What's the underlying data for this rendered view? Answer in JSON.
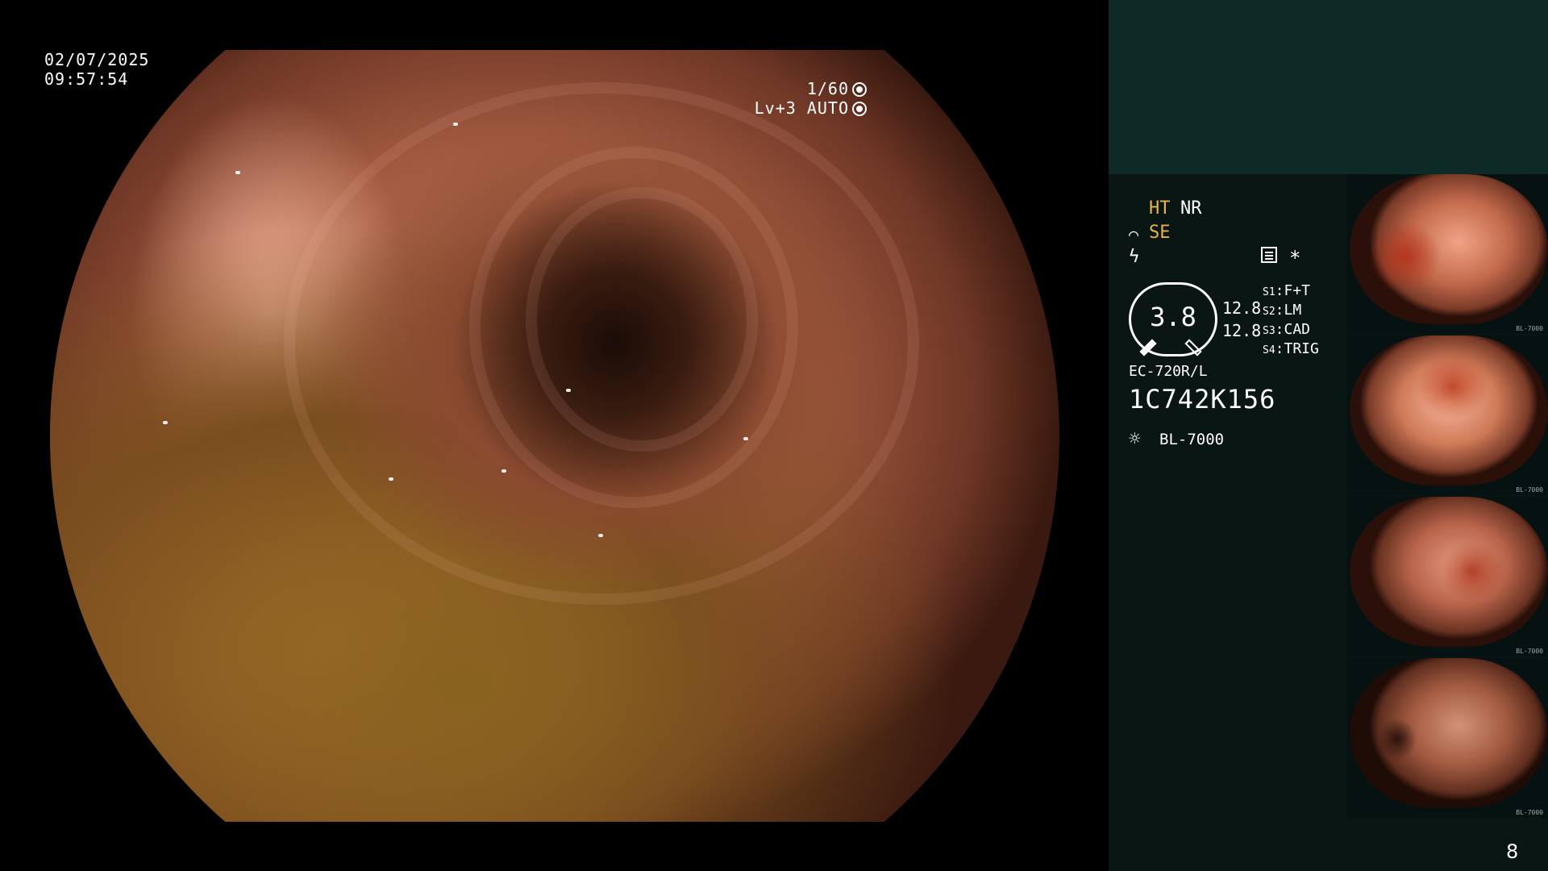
{
  "osd": {
    "date": "02/07/2025",
    "time": "09:57:54",
    "shutter": "1/60",
    "level": "Lv+3 AUTO"
  },
  "settings": {
    "ht": "HT",
    "nr": "NR",
    "se": "SE",
    "star": "*"
  },
  "gauge": {
    "value": "3.8",
    "num1": "12.8",
    "num2": "12.8"
  },
  "switches": [
    {
      "key": "S1",
      "label": "F+T"
    },
    {
      "key": "S2",
      "label": "LM"
    },
    {
      "key": "S3",
      "label": "CAD"
    },
    {
      "key": "S4",
      "label": "TRIG"
    }
  ],
  "scope": {
    "model": "EC-720R/L",
    "serial": "1C742K156",
    "light_source": "BL-7000"
  },
  "thumbnails": [
    {
      "caption": "BL-7000"
    },
    {
      "caption": "BL-7000"
    },
    {
      "caption": "BL-7000"
    },
    {
      "caption": "BL-7000"
    }
  ],
  "page": "8",
  "colors": {
    "panel": "#0a1614",
    "panel_top": "#0e2a27",
    "accent_amber": "#e8b24a"
  },
  "icons": [
    "shutter-gear-icon",
    "auto-iris-icon",
    "structure-enhance-icon",
    "color-bolt-icon",
    "notes-icon",
    "light-source-icon"
  ]
}
